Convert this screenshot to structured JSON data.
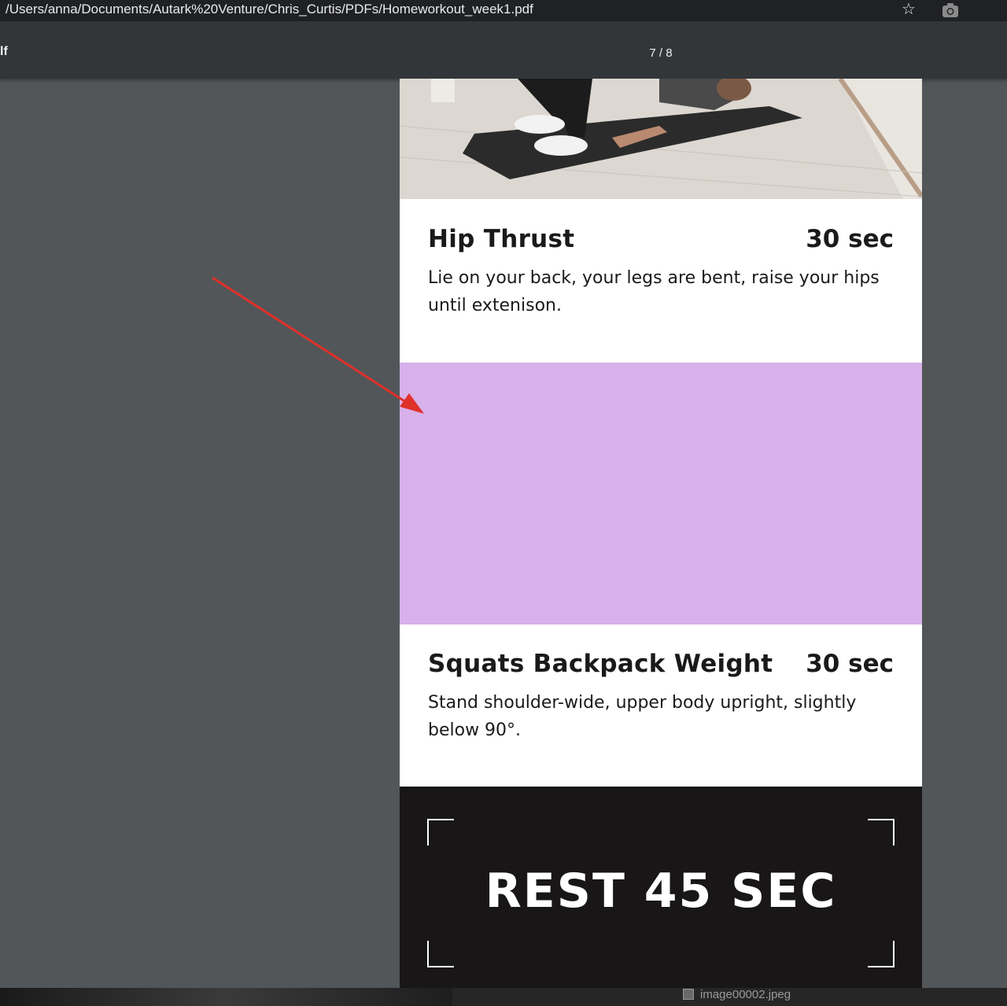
{
  "browser": {
    "url": "/Users/anna/Documents/Autark%20Venture/Chris_Curtis/PDFs/Homeworkout_week1.pdf",
    "star_icon": "star-icon",
    "camera_icon": "camera-icon"
  },
  "viewer": {
    "title": "lf",
    "page_indicator": "7 / 8"
  },
  "pdf_page": {
    "exercises": [
      {
        "name": "Hip Thrust",
        "duration": "30 sec",
        "description": "Lie on your back, your legs are bent, raise your hips until extenison."
      },
      {
        "name": "Squats Backpack Weight",
        "duration": "30 sec",
        "description": "Stand shoulder-wide, upper body upright, slightly below 90°."
      }
    ],
    "placeholder_color": "#d8b0ea",
    "rest_label": "REST 45 SEC"
  },
  "annotation": {
    "arrow_color": "#e0302a"
  },
  "taskbar": {
    "file_name": "image00002.jpeg"
  }
}
